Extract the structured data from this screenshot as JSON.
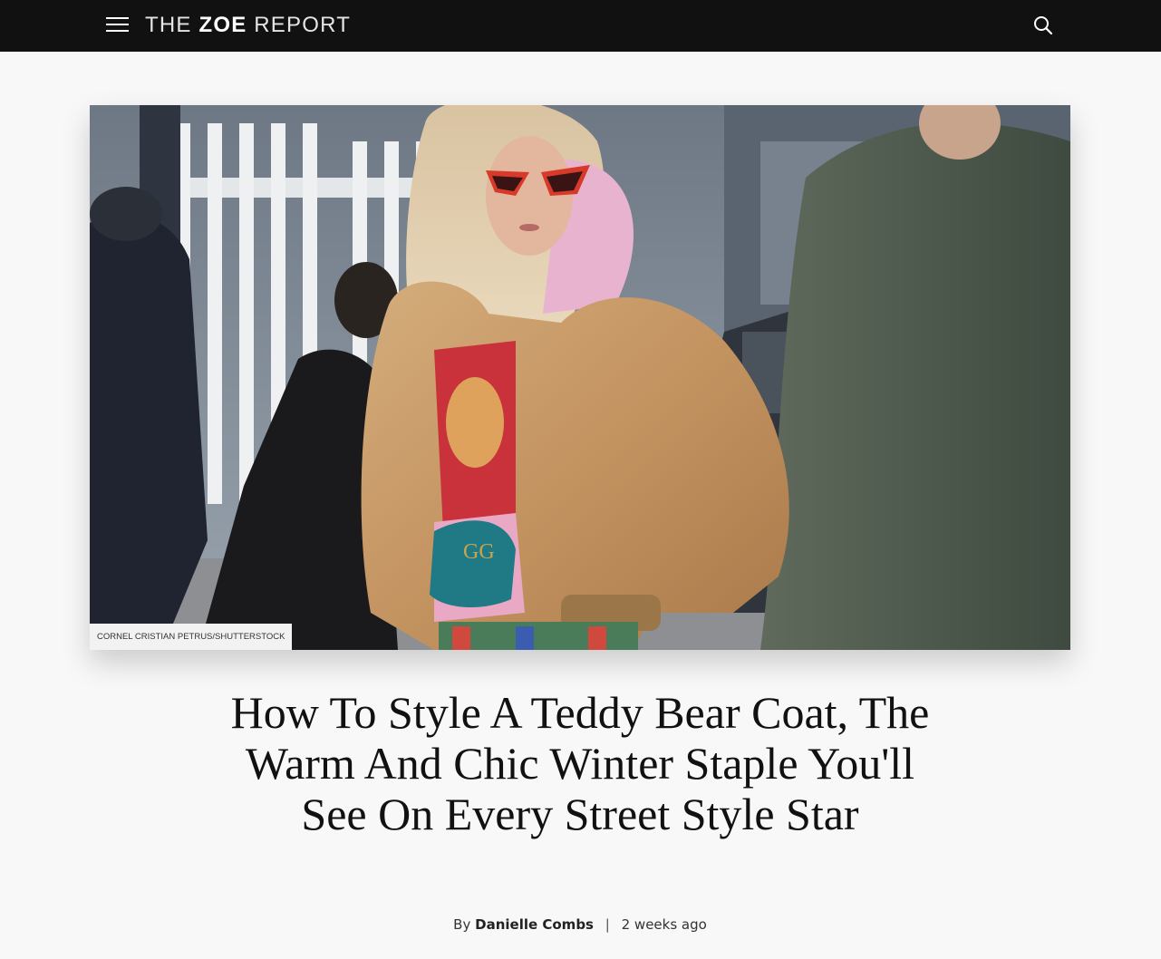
{
  "header": {
    "menu_icon": "hamburger-menu-icon",
    "logo_part1": "THE ",
    "logo_part2": "ZOE",
    "logo_part3": " REPORT",
    "search_icon": "search-icon",
    "background_color": "#111111"
  },
  "hero": {
    "photo_credit": "CORNEL CRISTIAN PETRUS/SHUTTERSTOCK"
  },
  "article": {
    "title": "How To Style A Teddy Bear Coat, The Warm And Chic Winter Staple You'll See On Every Street Style Star",
    "byline_prefix": "By",
    "author": "Danielle Combs",
    "separator": "|",
    "published": "2 weeks ago"
  }
}
